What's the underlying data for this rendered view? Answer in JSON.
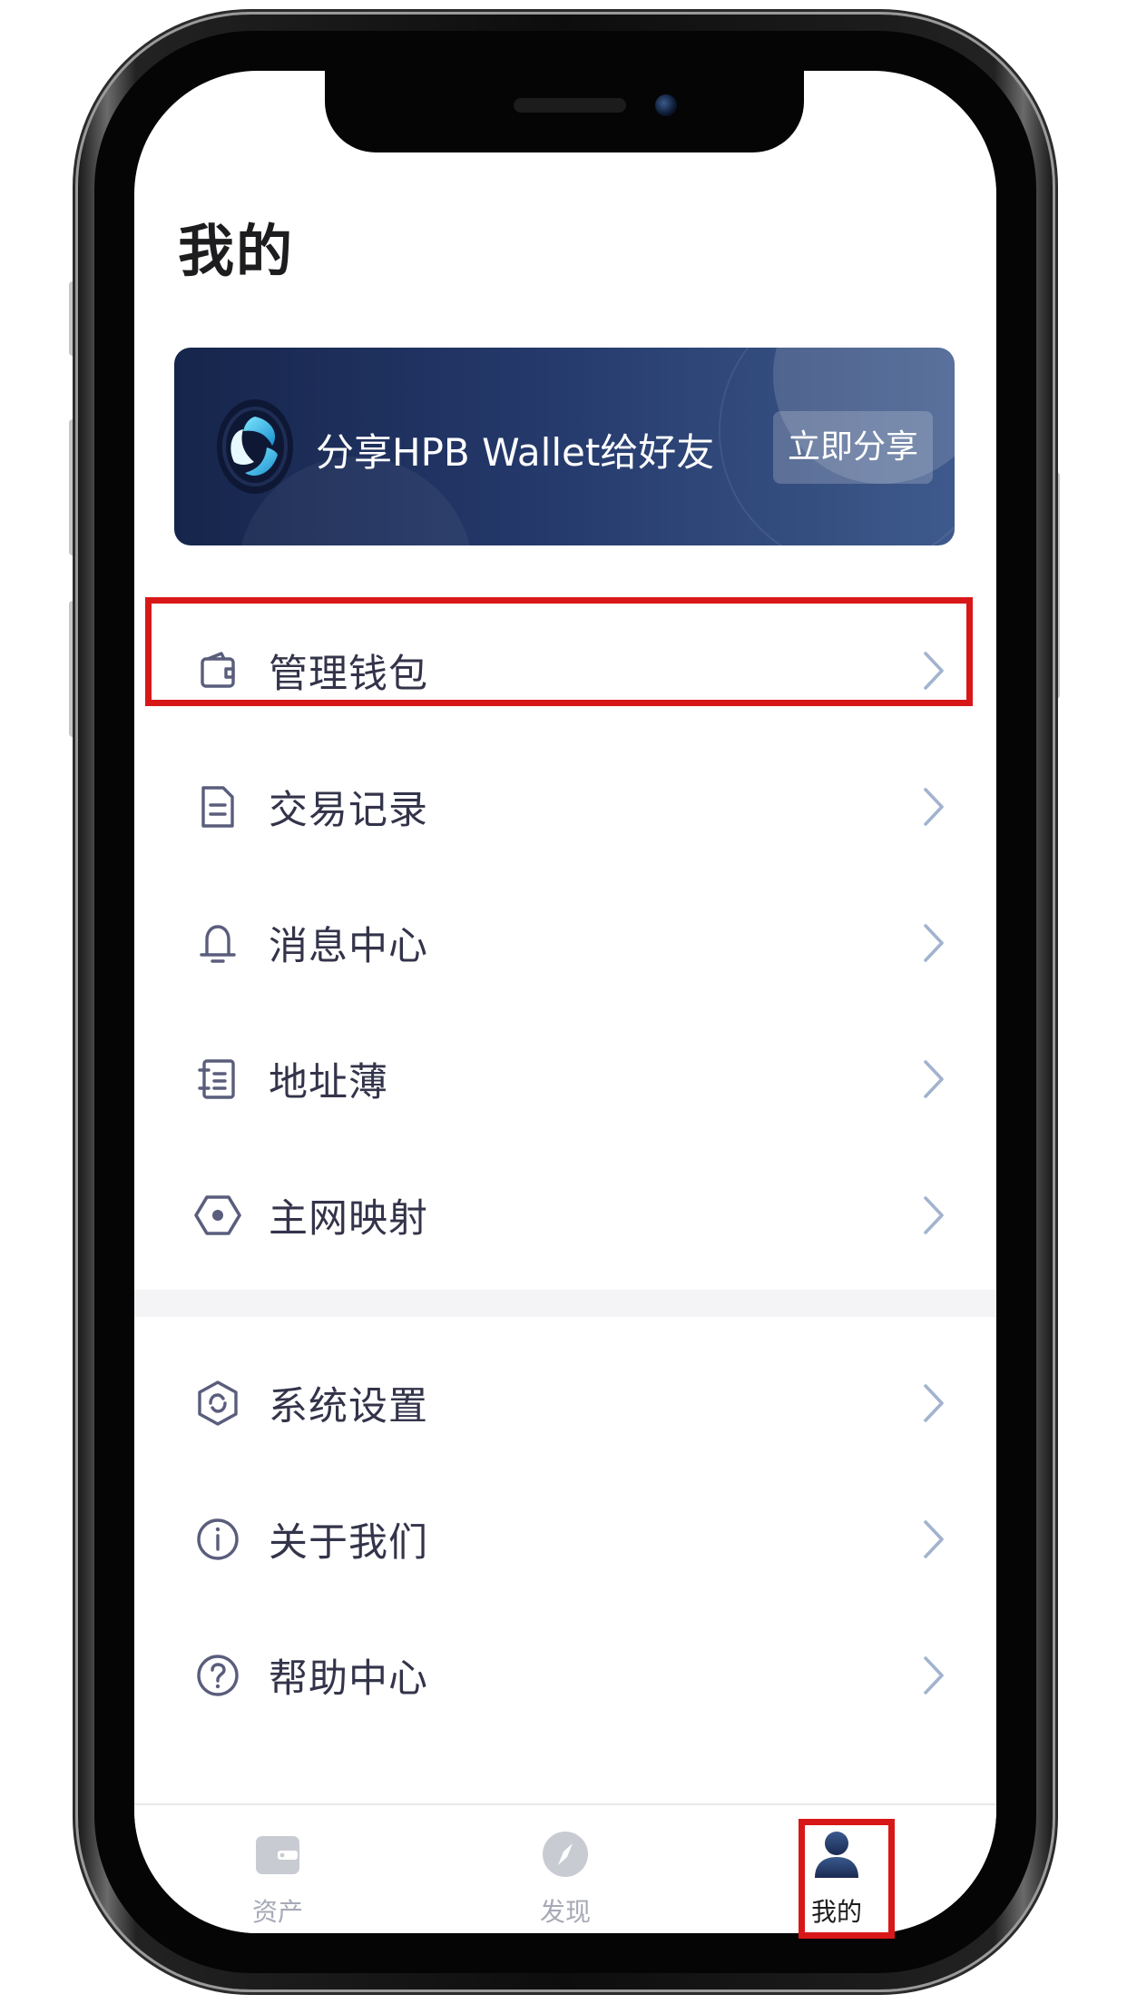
{
  "page": {
    "title": "我的"
  },
  "banner": {
    "text": "分享HPB Wallet给好友",
    "button_label": "立即分享",
    "logo_icon": "hpb-logo-icon"
  },
  "menu": {
    "group1": [
      {
        "label": "管理钱包",
        "icon": "wallet-icon",
        "highlighted": true
      },
      {
        "label": "交易记录",
        "icon": "document-icon"
      },
      {
        "label": "消息中心",
        "icon": "bell-icon"
      },
      {
        "label": "地址薄",
        "icon": "address-book-icon"
      },
      {
        "label": "主网映射",
        "icon": "hexagon-dot-icon"
      }
    ],
    "group2": [
      {
        "label": "系统设置",
        "icon": "settings-icon"
      },
      {
        "label": "关于我们",
        "icon": "info-icon"
      },
      {
        "label": "帮助中心",
        "icon": "help-icon"
      }
    ]
  },
  "tabbar": {
    "tabs": [
      {
        "label": "资产",
        "icon": "wallet-tab-icon",
        "active": false
      },
      {
        "label": "发现",
        "icon": "compass-icon",
        "active": false
      },
      {
        "label": "我的",
        "icon": "person-icon",
        "active": true
      }
    ]
  },
  "colors": {
    "highlight": "#d81818",
    "icon_stroke": "#5a5d7c",
    "chevron": "#a2b3cf",
    "banner_start": "#16254b",
    "banner_end": "#3e5a8c",
    "tab_inactive": "#a7a9b6"
  }
}
